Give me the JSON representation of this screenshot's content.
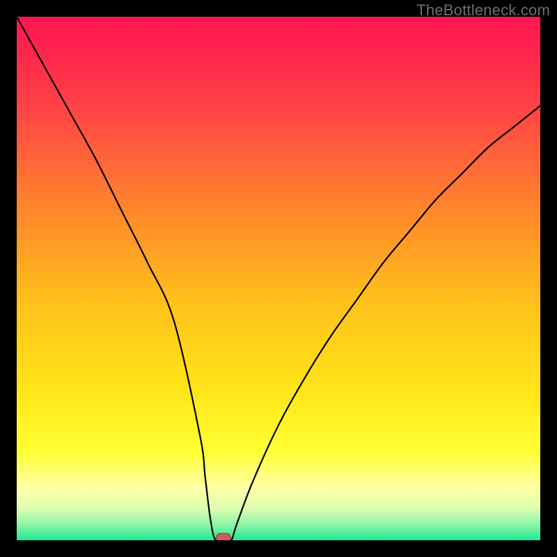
{
  "watermark": "TheBottleneck.com",
  "chart_data": {
    "type": "line",
    "title": "",
    "xlabel": "",
    "ylabel": "",
    "xlim": [
      0,
      100
    ],
    "ylim": [
      0,
      100
    ],
    "grid": false,
    "legend": false,
    "series": [
      {
        "name": "curve",
        "x": [
          0,
          5,
          10,
          15,
          20,
          25,
          30,
          35,
          36,
          37,
          38,
          40,
          41,
          42,
          45,
          50,
          55,
          60,
          65,
          70,
          75,
          80,
          85,
          90,
          95,
          100
        ],
        "values": [
          100,
          91,
          82,
          73,
          63,
          53,
          42,
          20,
          12,
          4,
          0,
          0,
          0,
          3,
          11,
          22,
          31,
          39,
          46,
          53,
          59,
          65,
          70,
          75,
          79,
          83
        ]
      }
    ],
    "marker": {
      "x": 39.5,
      "y": 0.5,
      "shape": "rounded-rect",
      "fill": "#d15a5a",
      "stroke": "#8f2e2e"
    },
    "background_gradient": {
      "stops": [
        {
          "offset": 0.0,
          "color": "#ff1452"
        },
        {
          "offset": 0.18,
          "color": "#ff4545"
        },
        {
          "offset": 0.38,
          "color": "#ff8a2a"
        },
        {
          "offset": 0.55,
          "color": "#ffc21a"
        },
        {
          "offset": 0.72,
          "color": "#ffe61a"
        },
        {
          "offset": 0.83,
          "color": "#ffff33"
        },
        {
          "offset": 0.9,
          "color": "#ffffa8"
        },
        {
          "offset": 0.94,
          "color": "#dcffb0"
        },
        {
          "offset": 0.97,
          "color": "#8cf5a8"
        },
        {
          "offset": 1.0,
          "color": "#1fe890"
        }
      ]
    }
  }
}
